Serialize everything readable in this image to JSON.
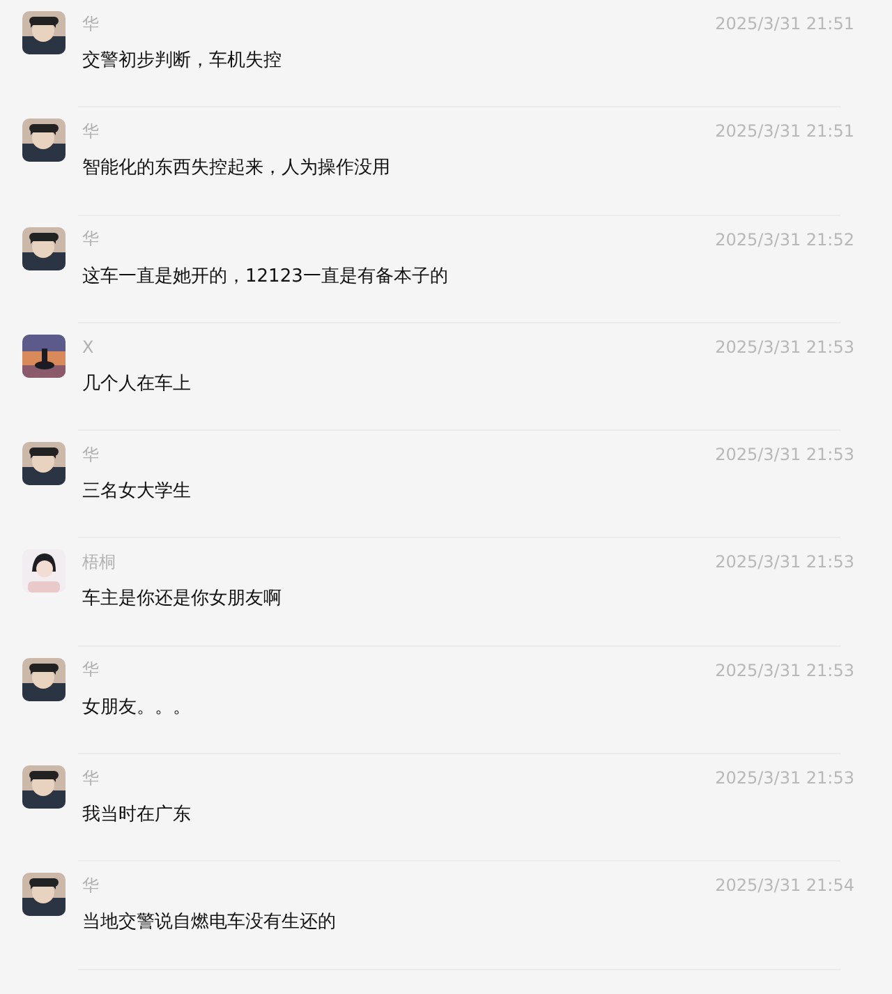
{
  "messages": [
    {
      "name": "华",
      "time": "2025/3/31 21:51",
      "text": "交警初步判断，车机失控"
    },
    {
      "name": "华",
      "time": "2025/3/31 21:51",
      "text": "智能化的东西失控起来，人为操作没用"
    },
    {
      "name": "华",
      "time": "2025/3/31 21:52",
      "text": "这车一直是她开的，12123一直是有备本子的"
    },
    {
      "name": "X",
      "time": "2025/3/31 21:53",
      "text": "几个人在车上"
    },
    {
      "name": "华",
      "time": "2025/3/31 21:53",
      "text": "三名女大学生"
    },
    {
      "name": "梧桐",
      "time": "2025/3/31 21:53",
      "text": "车主是你还是你女朋友啊"
    },
    {
      "name": "华",
      "time": "2025/3/31 21:53",
      "text": "女朋友。。。"
    },
    {
      "name": "华",
      "time": "2025/3/31 21:53",
      "text": "我当时在广东"
    },
    {
      "name": "华",
      "time": "2025/3/31 21:54",
      "text": "当地交警说自燃电车没有生还的"
    }
  ]
}
